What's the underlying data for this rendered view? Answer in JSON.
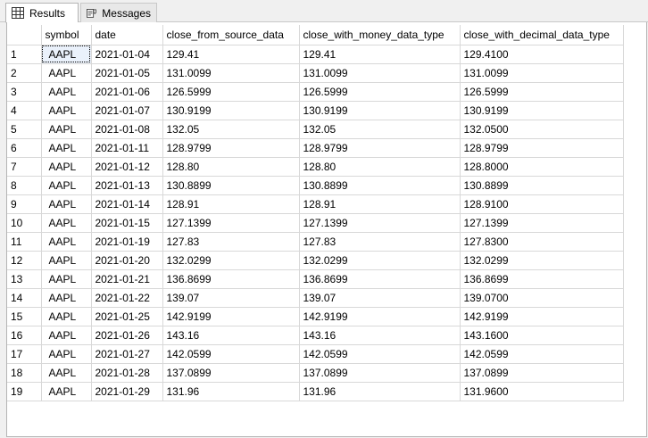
{
  "tabs": [
    {
      "label": "Results",
      "icon": "grid-icon",
      "active": true
    },
    {
      "label": "Messages",
      "icon": "messages-icon",
      "active": false
    }
  ],
  "columns": [
    "",
    "symbol",
    "date",
    "close_from_source_data",
    "close_with_money_data_type",
    "close_with_decimal_data_type"
  ],
  "rows": [
    [
      "1",
      "AAPL",
      "2021-01-04",
      "129.41",
      "129.41",
      "129.4100"
    ],
    [
      "2",
      "AAPL",
      "2021-01-05",
      "131.0099",
      "131.0099",
      "131.0099"
    ],
    [
      "3",
      "AAPL",
      "2021-01-06",
      "126.5999",
      "126.5999",
      "126.5999"
    ],
    [
      "4",
      "AAPL",
      "2021-01-07",
      "130.9199",
      "130.9199",
      "130.9199"
    ],
    [
      "5",
      "AAPL",
      "2021-01-08",
      "132.05",
      "132.05",
      "132.0500"
    ],
    [
      "6",
      "AAPL",
      "2021-01-11",
      "128.9799",
      "128.9799",
      "128.9799"
    ],
    [
      "7",
      "AAPL",
      "2021-01-12",
      "128.80",
      "128.80",
      "128.8000"
    ],
    [
      "8",
      "AAPL",
      "2021-01-13",
      "130.8899",
      "130.8899",
      "130.8899"
    ],
    [
      "9",
      "AAPL",
      "2021-01-14",
      "128.91",
      "128.91",
      "128.9100"
    ],
    [
      "10",
      "AAPL",
      "2021-01-15",
      "127.1399",
      "127.1399",
      "127.1399"
    ],
    [
      "11",
      "AAPL",
      "2021-01-19",
      "127.83",
      "127.83",
      "127.8300"
    ],
    [
      "12",
      "AAPL",
      "2021-01-20",
      "132.0299",
      "132.0299",
      "132.0299"
    ],
    [
      "13",
      "AAPL",
      "2021-01-21",
      "136.8699",
      "136.8699",
      "136.8699"
    ],
    [
      "14",
      "AAPL",
      "2021-01-22",
      "139.07",
      "139.07",
      "139.0700"
    ],
    [
      "15",
      "AAPL",
      "2021-01-25",
      "142.9199",
      "142.9199",
      "142.9199"
    ],
    [
      "16",
      "AAPL",
      "2021-01-26",
      "143.16",
      "143.16",
      "143.1600"
    ],
    [
      "17",
      "AAPL",
      "2021-01-27",
      "142.0599",
      "142.0599",
      "142.0599"
    ],
    [
      "18",
      "AAPL",
      "2021-01-28",
      "137.0899",
      "137.0899",
      "137.0899"
    ],
    [
      "19",
      "AAPL",
      "2021-01-29",
      "131.96",
      "131.96",
      "131.9600"
    ]
  ]
}
